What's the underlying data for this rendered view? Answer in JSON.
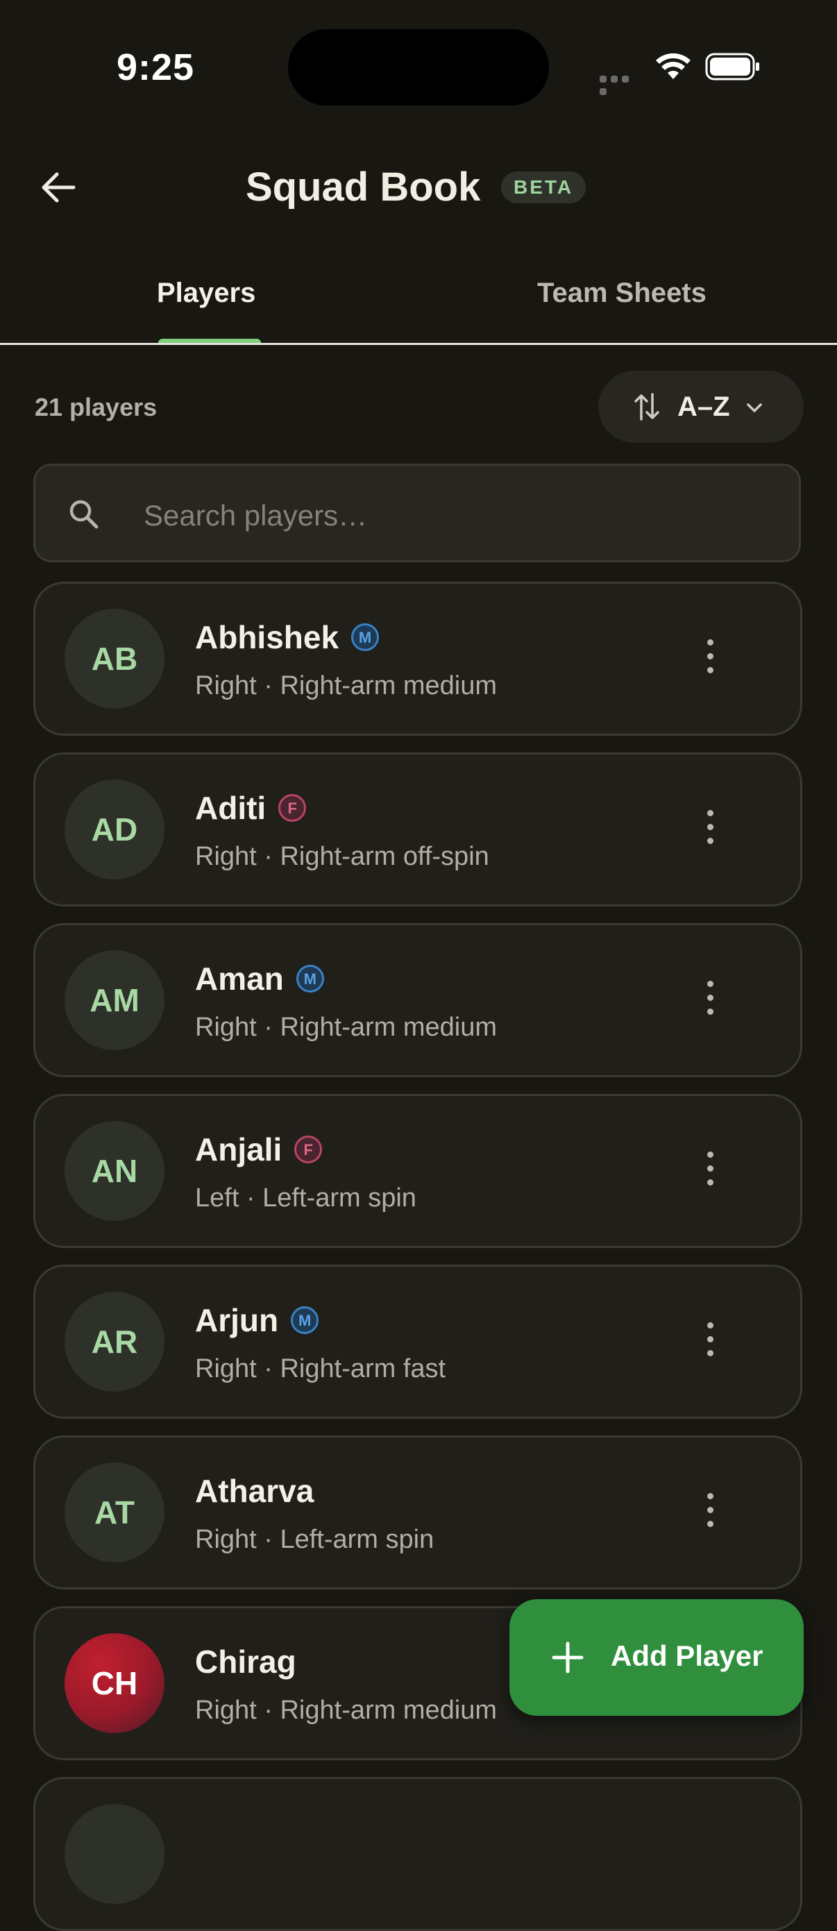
{
  "status_bar": {
    "time": "9:25"
  },
  "header": {
    "title": "Squad Book",
    "badge": "BETA"
  },
  "tabs": [
    {
      "label": "Players",
      "active": true
    },
    {
      "label": "Team Sheets",
      "active": false
    }
  ],
  "list_header": {
    "count": "21 players",
    "sort_label": "A–Z"
  },
  "search": {
    "placeholder": "Search players…",
    "value": ""
  },
  "players": [
    {
      "initials": "AB",
      "name": "Abhishek",
      "gender": "M",
      "desc": "Right · Right-arm medium"
    },
    {
      "initials": "AD",
      "name": "Aditi",
      "gender": "F",
      "desc": "Right · Right-arm off-spin"
    },
    {
      "initials": "AM",
      "name": "Aman",
      "gender": "M",
      "desc": "Right · Right-arm medium"
    },
    {
      "initials": "AN",
      "name": "Anjali",
      "gender": "F",
      "desc": "Left · Left-arm spin"
    },
    {
      "initials": "AR",
      "name": "Arjun",
      "gender": "M",
      "desc": "Right · Right-arm fast"
    },
    {
      "initials": "AT",
      "name": "Atharva",
      "gender": "",
      "desc": "Right · Left-arm spin"
    },
    {
      "initials": "CH",
      "name": "Chirag",
      "gender": "",
      "desc": "Right · Right-arm medium"
    }
  ],
  "fab": {
    "label": "Add Player"
  },
  "colors": {
    "accent": "#7fcf7c",
    "fab": "#2f8f3d",
    "background": "#181712"
  }
}
